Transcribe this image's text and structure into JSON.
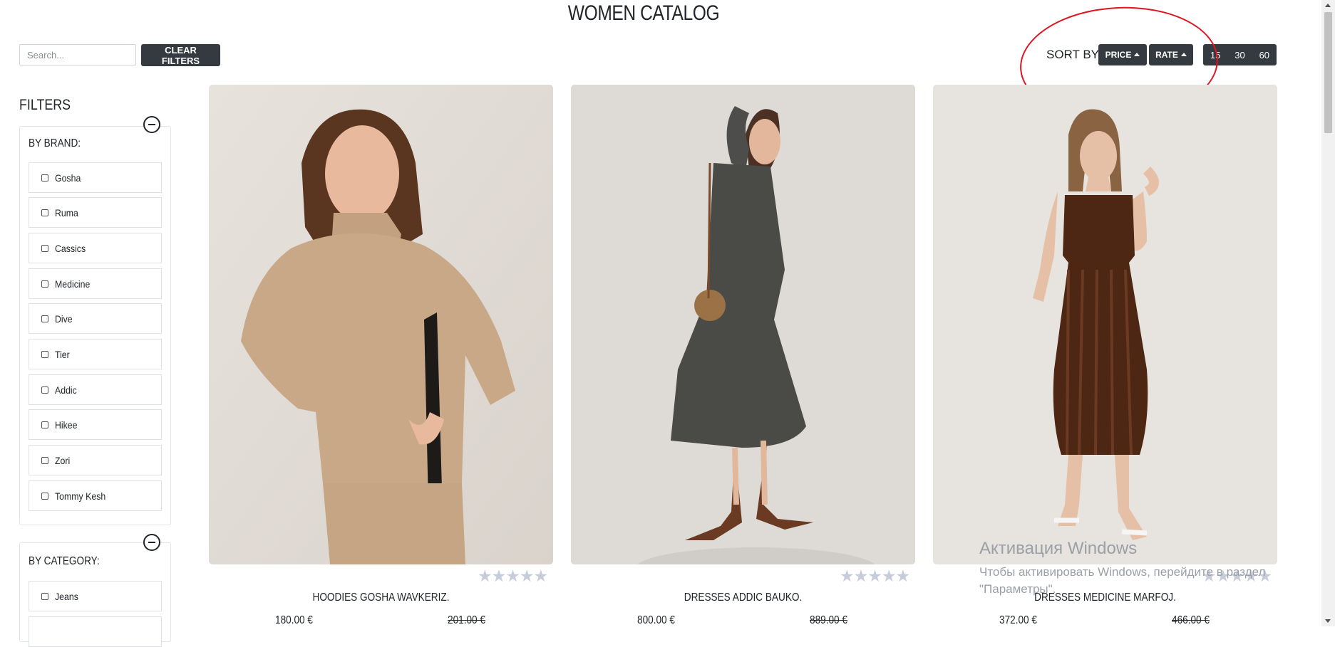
{
  "page": {
    "title": "WOMEN CATALOG"
  },
  "toolbar": {
    "search_placeholder": "Search...",
    "clear_filters_label": "CLEAR FILTERS",
    "sort_label": "SORT BY:",
    "sort_price_label": "PRICE",
    "sort_rate_label": "RATE",
    "page_sizes": [
      "15",
      "30",
      "60"
    ]
  },
  "filters": {
    "title": "FILTERS",
    "brand": {
      "title": "BY BRAND:",
      "items": [
        "Gosha",
        "Ruma",
        "Cassics",
        "Medicine",
        "Dive",
        "Tier",
        "Addic",
        "Hikee",
        "Zori",
        "Tommy Kesh"
      ]
    },
    "category": {
      "title": "BY CATEGORY:",
      "items": [
        "Jeans"
      ]
    }
  },
  "products": [
    {
      "name": "HOODIES GOSHA WAVKERIZ.",
      "price": "180.00 €",
      "old_price": "201.00 €",
      "rating": 0,
      "stars": "★★★★★"
    },
    {
      "name": "DRESSES ADDIC BAUKO.",
      "price": "800.00 €",
      "old_price": "889.00 €",
      "rating": 0,
      "stars": "★★★★★"
    },
    {
      "name": "DRESSES MEDICINE MARFOJ.",
      "price": "372.00 €",
      "old_price": "466.00 €",
      "rating": 0,
      "stars": "★★★★★"
    }
  ],
  "overlay": {
    "activation_title": "Активация Windows",
    "activation_line1": "Чтобы активировать Windows, перейдите в раздел",
    "activation_line2": "\"Параметры\"."
  },
  "colors": {
    "dark_button": "#343a40",
    "annotation": "#e0141e",
    "star_inactive": "#c6ccd8"
  },
  "icons": {
    "sort_direction": "caret-up-icon",
    "collapse": "minus-circle-icon",
    "checkbox": "checkbox-icon"
  }
}
